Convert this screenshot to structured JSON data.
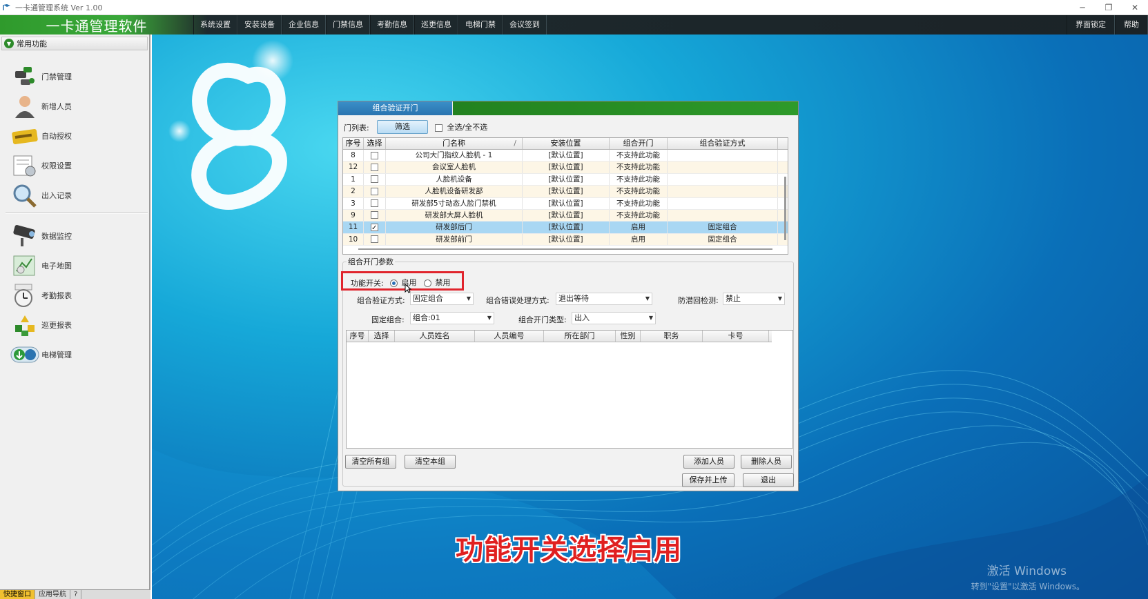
{
  "window": {
    "title": "一卡通管理系统  Ver 1.00",
    "minimize": "─",
    "restore": "❐",
    "close": "✕"
  },
  "menubar": {
    "brand": "一卡通管理软件",
    "items": [
      "系统设置",
      "安装设备",
      "企业信息",
      "门禁信息",
      "考勤信息",
      "巡更信息",
      "电梯门禁",
      "会议签到"
    ],
    "right_items": [
      "界面锁定",
      "帮助"
    ]
  },
  "sidebar": {
    "section_title": "常用功能",
    "items": [
      {
        "label": "门禁管理",
        "icon": "door-access-icon"
      },
      {
        "label": "新增人员",
        "icon": "person-icon"
      },
      {
        "label": "自动授权",
        "icon": "card-icon"
      },
      {
        "label": "权限设置",
        "icon": "permission-icon"
      },
      {
        "label": "出入记录",
        "icon": "magnifier-icon"
      },
      {
        "label": "数据监控",
        "icon": "camera-icon"
      },
      {
        "label": "电子地图",
        "icon": "map-icon"
      },
      {
        "label": "考勤报表",
        "icon": "clock-icon"
      },
      {
        "label": "巡更报表",
        "icon": "patrol-icon"
      },
      {
        "label": "电梯管理",
        "icon": "elevator-icon"
      }
    ],
    "bottom_tabs": [
      "快捷窗口",
      "应用导航",
      "?"
    ]
  },
  "dialog": {
    "title": "组合验证开门",
    "door_list_label": "门列表:",
    "filter_button": "筛选",
    "select_all_label": "全选/全不选",
    "door_table": {
      "columns": [
        "序号",
        "选择",
        "门名称",
        "安装位置",
        "组合开门",
        "组合验证方式"
      ],
      "sort_mark": "/",
      "rows": [
        {
          "no": "8",
          "checked": false,
          "name": "公司大门指纹人脸机 - 1",
          "location": "[默认位置]",
          "combo": "不支持此功能",
          "mode": ""
        },
        {
          "no": "12",
          "checked": false,
          "name": "会议室人脸机",
          "location": "[默认位置]",
          "combo": "不支持此功能",
          "mode": ""
        },
        {
          "no": "1",
          "checked": false,
          "name": "人脸机设备",
          "location": "[默认位置]",
          "combo": "不支持此功能",
          "mode": ""
        },
        {
          "no": "2",
          "checked": false,
          "name": "人脸机设备研发部",
          "location": "[默认位置]",
          "combo": "不支持此功能",
          "mode": ""
        },
        {
          "no": "3",
          "checked": false,
          "name": "研发部5寸动态人脸门禁机",
          "location": "[默认位置]",
          "combo": "不支持此功能",
          "mode": ""
        },
        {
          "no": "9",
          "checked": false,
          "name": "研发部大屏人脸机",
          "location": "[默认位置]",
          "combo": "不支持此功能",
          "mode": ""
        },
        {
          "no": "11",
          "checked": true,
          "name": "研发部后门",
          "location": "[默认位置]",
          "combo": "启用",
          "mode": "固定组合"
        },
        {
          "no": "10",
          "checked": false,
          "name": "研发部前门",
          "location": "[默认位置]",
          "combo": "启用",
          "mode": "固定组合"
        }
      ],
      "selected_row": 6
    },
    "params_title": "组合开门参数",
    "switch_label": "功能开关:",
    "switch_on": "启用",
    "switch_off": "禁用",
    "switch_value": "启用",
    "verify_mode_label": "组合验证方式:",
    "verify_mode_value": "固定组合",
    "error_mode_label": "组合错误处理方式:",
    "error_mode_value": "退出等待",
    "anti_passback_label": "防潜回检测:",
    "anti_passback_value": "禁止",
    "fixed_combo_label": "固定组合:",
    "fixed_combo_value": "组合:01",
    "open_type_label": "组合开门类型:",
    "open_type_value": "出入",
    "person_table": {
      "columns": [
        "序号",
        "选择",
        "人员姓名",
        "人员编号",
        "所在部门",
        "性别",
        "职务",
        "卡号"
      ],
      "rows": []
    },
    "buttons": {
      "clear_all_groups": "清空所有组",
      "clear_group": "清空本组",
      "add_person": "添加人员",
      "delete_person": "删除人员",
      "save_upload": "保存并上传",
      "exit": "退出"
    }
  },
  "caption": "功能开关选择启用",
  "watermark": {
    "line1": "激活 Windows",
    "line2": "转到\"设置\"以激活 Windows。"
  },
  "colors": {
    "menubar_green": "#2f9a2c",
    "menubar_dark": "#1b2327",
    "desktop_blue": "#0a6fb8",
    "highlight_red": "#e0242c",
    "selected_row": "#a9d7f3"
  }
}
